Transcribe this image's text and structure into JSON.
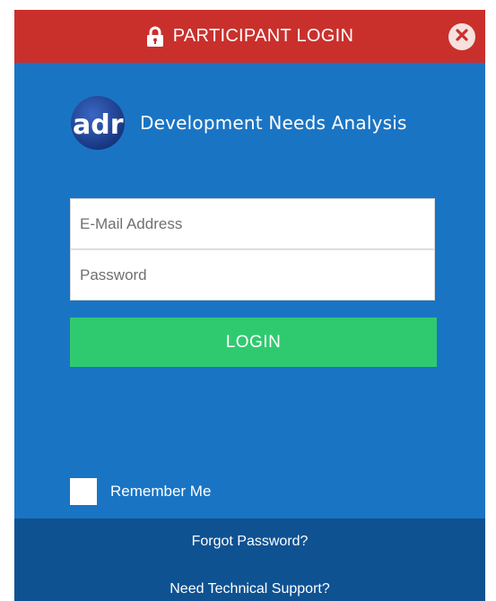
{
  "header": {
    "title": "PARTICIPANT LOGIN",
    "lock_icon": "lock-icon",
    "close_icon": "close-icon"
  },
  "brand": {
    "logo_text": "adr",
    "name": "Development Needs Analysis"
  },
  "form": {
    "email": {
      "value": "",
      "placeholder": "E-Mail Address"
    },
    "password": {
      "value": "",
      "placeholder": "Password"
    },
    "login_label": "LOGIN",
    "remember_label": "Remember Me",
    "remember_checked": false
  },
  "footer": {
    "forgot_label": "Forgot Password?",
    "support_label": "Need Technical Support?"
  },
  "colors": {
    "header": "#c9302c",
    "panel": "#1a74c4",
    "footer": "#0e5292",
    "login_button": "#2fca6f",
    "logo_circle": "#1a3f8f"
  }
}
